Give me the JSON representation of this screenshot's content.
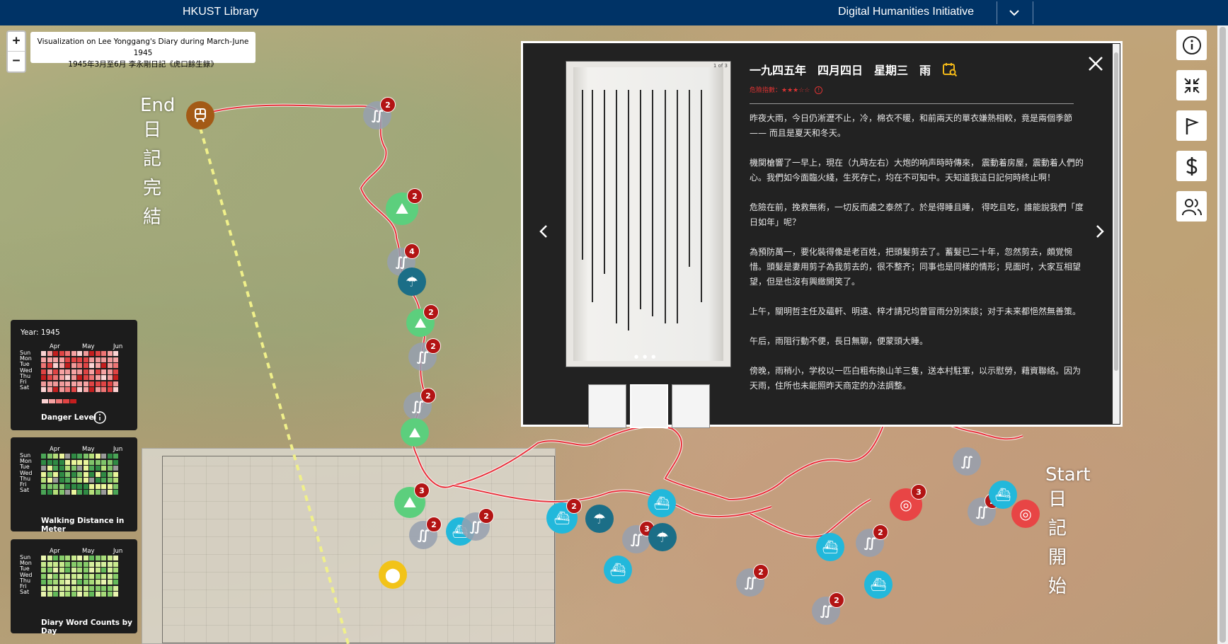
{
  "topbar": {
    "library": "HKUST Library",
    "initiative": "Digital Humanities Initiative"
  },
  "zoom": {
    "in": "+",
    "out": "−"
  },
  "title": {
    "line1": "Visualization on Lee Yonggang's Diary during March-June 1945",
    "line2": "1945年3月至6月 李永剛日記《虎口餘生錄》"
  },
  "labels": {
    "end_en": "End",
    "end_zh": [
      "日",
      "記",
      "完",
      "結"
    ],
    "start_en": "Start",
    "start_zh": [
      "日",
      "記",
      "開",
      "始"
    ]
  },
  "legends": [
    {
      "year": "Year: 1945",
      "months": [
        "Apr",
        "May",
        "Jun"
      ],
      "days": [
        "Sun",
        "Mon",
        "Tue",
        "Wed",
        "Thu",
        "Fri",
        "Sat"
      ],
      "caption": "Danger Level",
      "palette": "red"
    },
    {
      "months": [
        "Apr",
        "May",
        "Jun"
      ],
      "days": [
        "Sun",
        "Mon",
        "Tue",
        "Wed",
        "Thu",
        "Fri",
        "Sat"
      ],
      "caption": "Walking Distance in Meter",
      "palette": "green"
    },
    {
      "months": [
        "Apr",
        "May",
        "Jun"
      ],
      "days": [
        "Sun",
        "Mon",
        "Tue",
        "Wed",
        "Thu",
        "Fri",
        "Sat"
      ],
      "caption": "Diary Word Counts by Day",
      "palette": "lightgreen"
    }
  ],
  "colors": {
    "topbar": "#003366",
    "route": "#e8323c",
    "danger_badge": "#b31414",
    "marker_gray": "#96a0af",
    "marker_green": "#5ccf7d",
    "marker_cyan": "#22b8db",
    "marker_teal": "#1b6e87",
    "marker_red": "#e84545",
    "marker_brown": "#a35a16",
    "marker_yellow": "#f2c318"
  },
  "toolbar": [
    "info-icon",
    "collapse-icon",
    "flag-icon",
    "dollar-icon",
    "people-icon"
  ],
  "markers": [
    {
      "kind": "brown",
      "icon": "train-icon"
    },
    {
      "kind": "gray",
      "icon": "footprints-icon",
      "count": "2"
    },
    {
      "kind": "green",
      "icon": "mountain-icon",
      "count": "2"
    },
    {
      "kind": "gray",
      "icon": "footprints-icon",
      "count": "4"
    },
    {
      "kind": "teal",
      "icon": "umbrella-icon"
    },
    {
      "kind": "green",
      "icon": "mountain-icon",
      "count": "2"
    },
    {
      "kind": "gray",
      "icon": "footprints-icon",
      "count": "2"
    },
    {
      "kind": "gray",
      "icon": "footprints-icon",
      "count": "2"
    },
    {
      "kind": "green",
      "icon": "mountain-icon"
    },
    {
      "kind": "green",
      "icon": "mountain-icon",
      "count": "3"
    },
    {
      "kind": "gray",
      "icon": "footprints-icon",
      "count": "2"
    },
    {
      "kind": "cyan",
      "icon": "boat-icon"
    },
    {
      "kind": "gray",
      "icon": "footprints-icon",
      "count": "2"
    },
    {
      "kind": "cyan",
      "icon": "boat-icon",
      "count": "2"
    },
    {
      "kind": "teal",
      "icon": "umbrella-icon"
    },
    {
      "kind": "cyan",
      "icon": "boat-icon"
    },
    {
      "kind": "gray",
      "icon": "footprints-icon",
      "count": "3"
    },
    {
      "kind": "teal",
      "icon": "umbrella-icon"
    },
    {
      "kind": "cyan",
      "icon": "boat-icon"
    },
    {
      "kind": "gray",
      "icon": "footprints-icon",
      "count": "2"
    },
    {
      "kind": "cyan",
      "icon": "boat-icon"
    },
    {
      "kind": "gray",
      "icon": "footprints-icon",
      "count": "2"
    },
    {
      "kind": "cyan",
      "icon": "boat-icon"
    },
    {
      "kind": "gray",
      "icon": "footprints-icon",
      "count": "2"
    },
    {
      "kind": "red",
      "icon": "target-icon",
      "count": "3"
    },
    {
      "kind": "gray",
      "icon": "footprints-icon",
      "count": "2"
    },
    {
      "kind": "gray",
      "icon": "footprints-icon"
    },
    {
      "kind": "cyan",
      "icon": "boat-icon"
    },
    {
      "kind": "red",
      "icon": "target-icon"
    },
    {
      "kind": "yellow",
      "icon": "location-pin-icon"
    }
  ],
  "modal": {
    "date": "一九四五年",
    "month_day": "四月四日",
    "weekday": "星期三",
    "weather": "雨",
    "danger_label": "危險指數：★★★☆☆",
    "page_indicator": "1 of 3",
    "paragraphs": [
      "昨夜大雨，今日仍淅瀝不止，冷，棉衣不暖，和前兩天的單衣嫌熱相較，竟是兩個季節 —— 而且是夏天和冬天。",
      "機関槍響了一早上，現在（九時左右）大炮的响声時時傳來， 震動着房屋，震動着人們的心。我們如今面臨火綫，生死存亡，均在不可知中。天知道我這日記何時終止啊！",
      "危險在前，挽救無術，一切反而處之泰然了。於是得睡且睡， 得吃且吃，誰能說我們「度日如年」呢？",
      "為預防萬一，要化裝得像是老百姓，把頭髮剪去了。蓄髮已二十年，忽然剪去，頗覚惋惜。頭髮是妻用剪子為我剪去的，很不整齐；同事也是同樣的情形；見面时，大家互相望望，但是也沒有興緻開笑了。",
      "上午，關明哲主任及蘊軒、明遠、梓才請兄均曾冒雨分別來談；对于未来都悒然無善策。",
      "午后，雨阻行動不便，長日無聊，便蒙頭大睡。",
      "傍晚，雨稍小，学校以一匹白粗布換山羊三隻，送本村駐軍，以示慰勞，藉資聯絡。因为天雨，住所也未能照昨天商定的办法調整。"
    ]
  }
}
